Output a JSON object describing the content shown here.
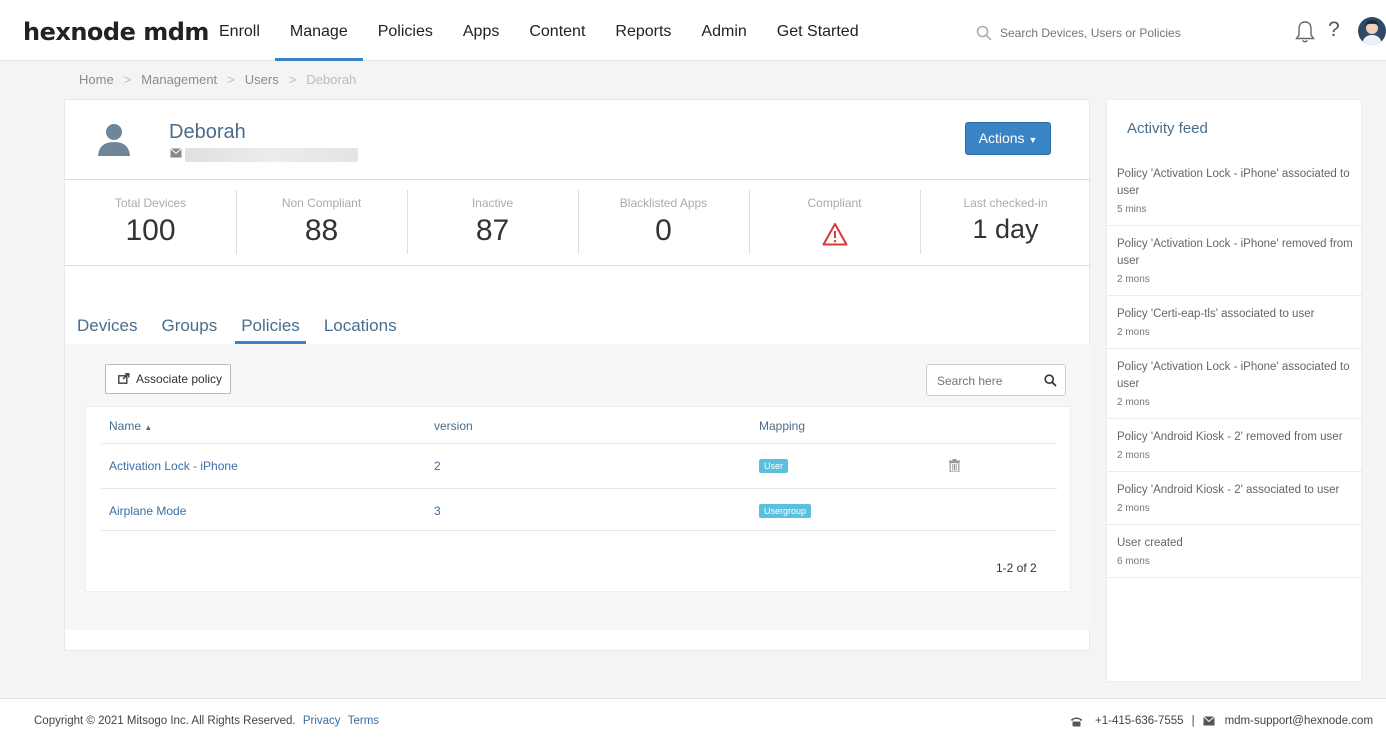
{
  "header": {
    "logo": "hexnode mdm",
    "nav": [
      {
        "label": "Enroll",
        "active": false
      },
      {
        "label": "Manage",
        "active": true
      },
      {
        "label": "Policies",
        "active": false
      },
      {
        "label": "Apps",
        "active": false
      },
      {
        "label": "Content",
        "active": false
      },
      {
        "label": "Reports",
        "active": false
      },
      {
        "label": "Admin",
        "active": false
      },
      {
        "label": "Get Started",
        "active": false
      }
    ],
    "search_placeholder": "Search Devices, Users or Policies",
    "help_label": "?"
  },
  "breadcrumb": {
    "items": [
      "Home",
      "Management",
      "Users",
      "Deborah"
    ],
    "separator": ">"
  },
  "user": {
    "name": "Deborah",
    "actions_label": "Actions"
  },
  "stats": [
    {
      "label": "Total Devices",
      "value": "100"
    },
    {
      "label": "Non Compliant",
      "value": "88"
    },
    {
      "label": "Inactive",
      "value": "87"
    },
    {
      "label": "Blacklisted Apps",
      "value": "0"
    },
    {
      "label": "Compliant",
      "value": "",
      "icon": "warning-icon"
    },
    {
      "label": "Last checked-in",
      "value": "1 day"
    }
  ],
  "tabs": [
    {
      "label": "Devices",
      "active": false
    },
    {
      "label": "Groups",
      "active": false
    },
    {
      "label": "Policies",
      "active": true
    },
    {
      "label": "Locations",
      "active": false
    }
  ],
  "policies": {
    "associate_label": "Associate policy",
    "search_placeholder": "Search here",
    "columns": {
      "name": "Name",
      "version": "version",
      "mapping": "Mapping"
    },
    "rows": [
      {
        "name": "Activation Lock - iPhone",
        "version": "2",
        "mapping": "User"
      },
      {
        "name": "Airplane Mode",
        "version": "3",
        "mapping": "Usergroup"
      }
    ],
    "pager": "1-2 of 2"
  },
  "activity_feed": {
    "title": "Activity feed",
    "items": [
      {
        "text": "Policy 'Activation Lock - iPhone' associated to user",
        "time": "5 mins"
      },
      {
        "text": "Policy 'Activation Lock - iPhone' removed from user",
        "time": "2 mons"
      },
      {
        "text": "Policy 'Certi-eap-tls' associated to user",
        "time": "2 mons"
      },
      {
        "text": "Policy 'Activation Lock - iPhone' associated to user",
        "time": "2 mons"
      },
      {
        "text": "Policy 'Android Kiosk - 2' removed from user",
        "time": "2 mons"
      },
      {
        "text": "Policy 'Android Kiosk - 2' associated to user",
        "time": "2 mons"
      },
      {
        "text": "User created",
        "time": "6 mons"
      }
    ]
  },
  "footer": {
    "copyright": "Copyright © 2021 Mitsogo Inc. All Rights Reserved.",
    "privacy": "Privacy",
    "terms": "Terms",
    "phone": "+1-415-636-7555",
    "divider": "|",
    "email": "mdm-support@hexnode.com"
  },
  "colors": {
    "accent": "#3a84c5",
    "link": "#3a6ea5",
    "badge": "#5bc0de",
    "warning": "#d9363e"
  }
}
